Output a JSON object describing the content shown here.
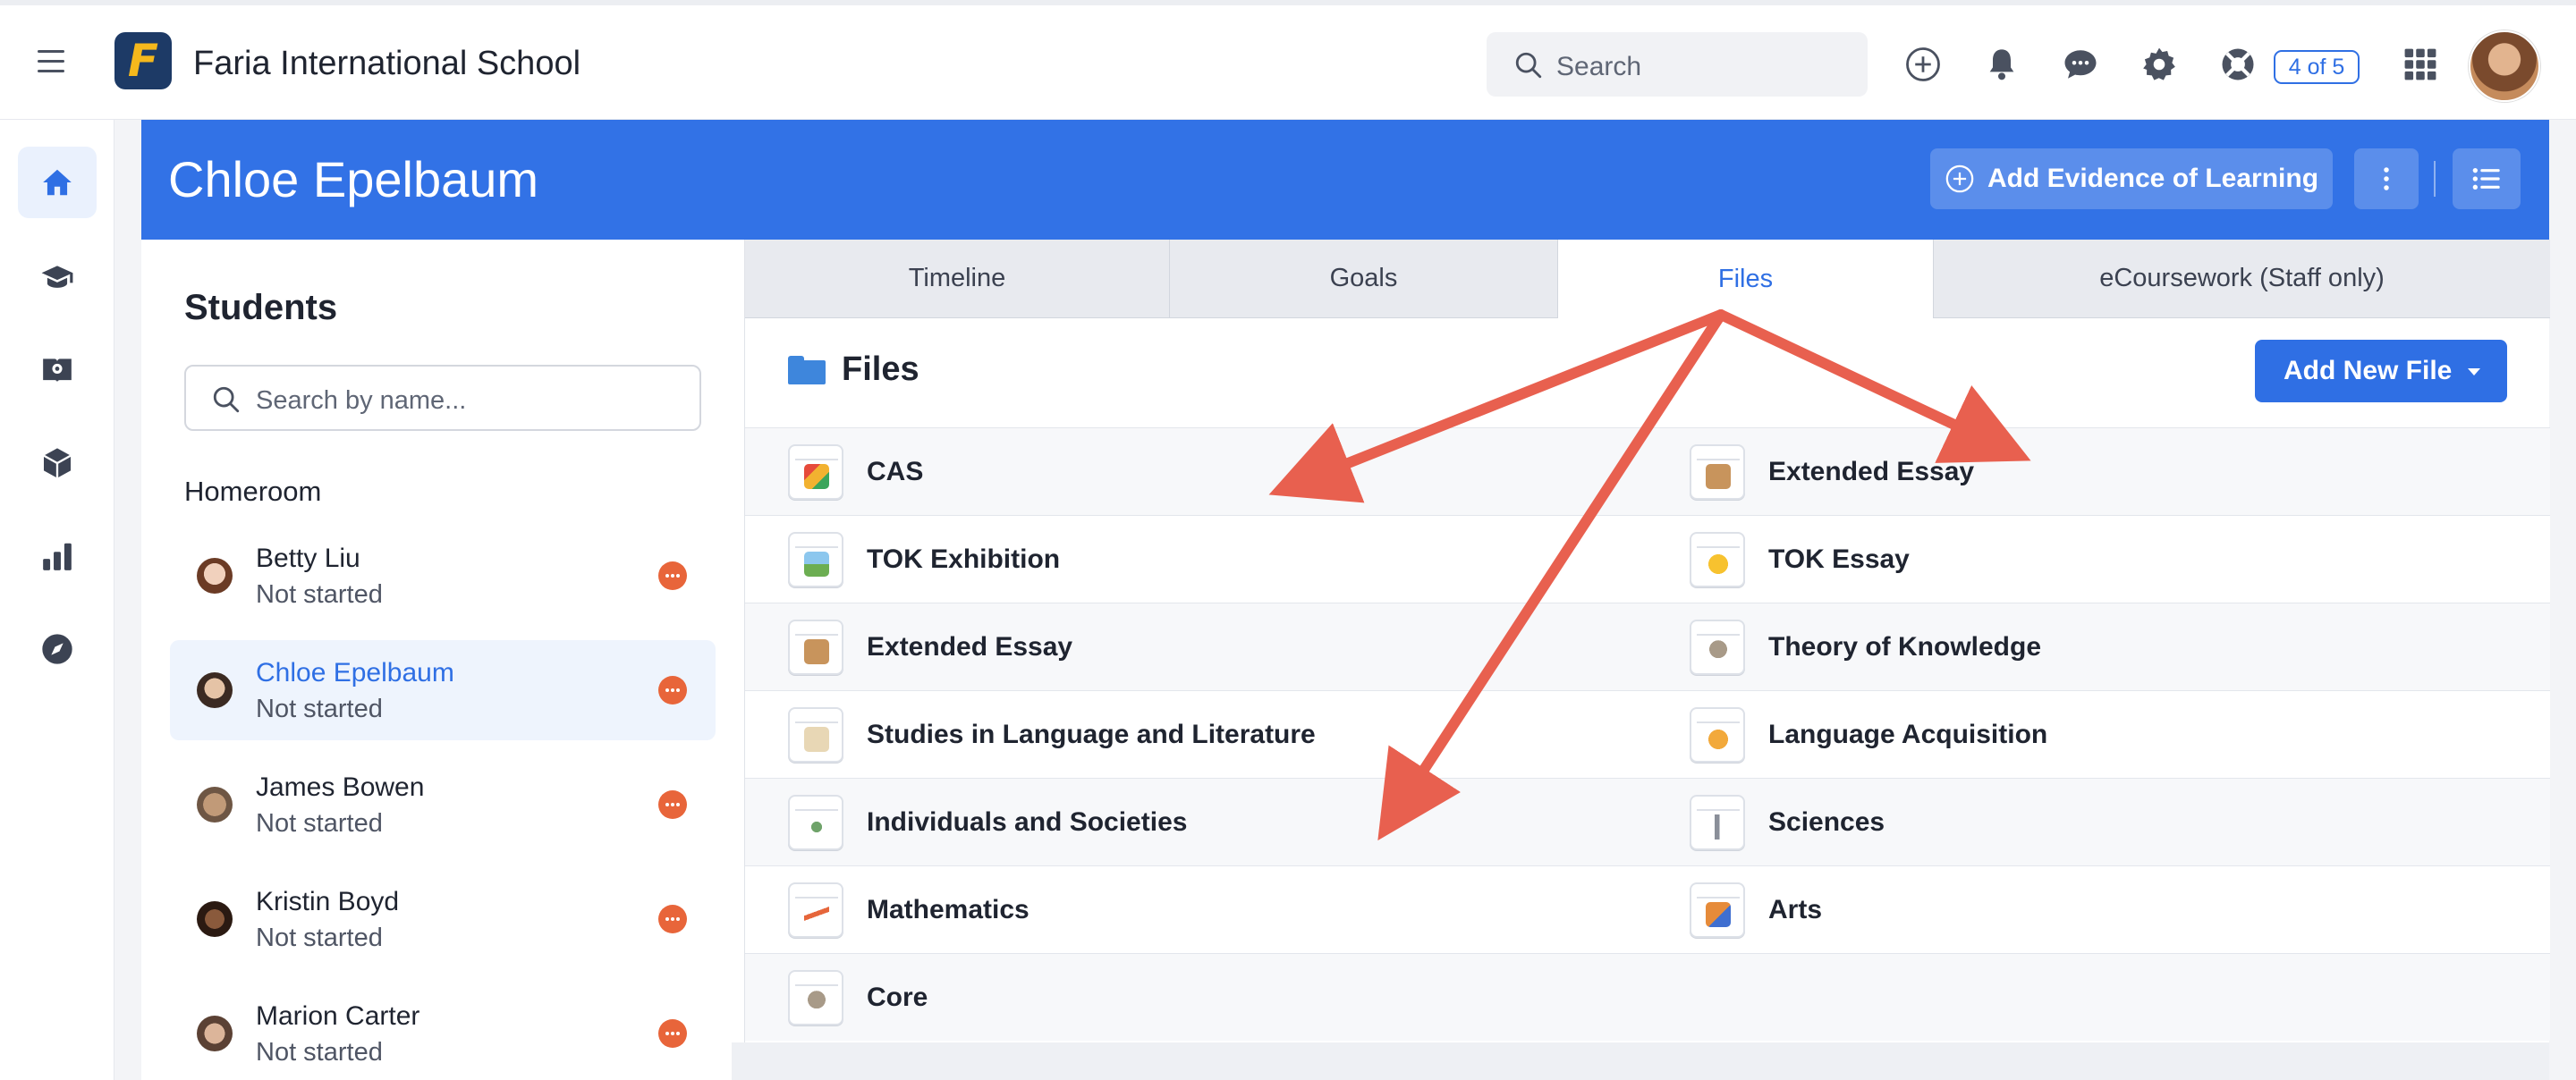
{
  "topbar": {
    "school_name": "Faria International School",
    "logo_letter": "F",
    "search_placeholder": "Search",
    "tasks_badge": "4 of 5",
    "icons": [
      "menu-icon",
      "plus-circle-icon",
      "bell-icon",
      "chat-icon",
      "gear-icon",
      "lifebuoy-icon",
      "apps-grid-icon",
      "user-avatar"
    ]
  },
  "rail": {
    "items": [
      "home-icon",
      "graduation-cap-icon",
      "book-icon",
      "cube-icon",
      "bar-chart-icon",
      "compass-icon"
    ],
    "active": "home-icon"
  },
  "header": {
    "student_name": "Chloe Epelbaum",
    "add_evidence_label": "Add Evidence of Learning"
  },
  "students": {
    "title": "Students",
    "search_placeholder": "Search by name...",
    "group": "Homeroom",
    "items": [
      {
        "name": "Betty Liu",
        "status": "Not started"
      },
      {
        "name": "Chloe Epelbaum",
        "status": "Not started",
        "active": true
      },
      {
        "name": "James Bowen",
        "status": "Not started"
      },
      {
        "name": "Kristin Boyd",
        "status": "Not started"
      },
      {
        "name": "Marion Carter",
        "status": "Not started"
      }
    ]
  },
  "tabs": [
    {
      "label": "Timeline"
    },
    {
      "label": "Goals"
    },
    {
      "label": "Files",
      "active": true
    },
    {
      "label": "eCoursework (Staff only)"
    }
  ],
  "files": {
    "title": "Files",
    "add_button": "Add New File",
    "folders": [
      [
        "CAS",
        "Extended Essay"
      ],
      [
        "TOK Exhibition",
        "TOK Essay"
      ],
      [
        "Extended Essay",
        "Theory of Knowledge"
      ],
      [
        "Studies in Language and Literature",
        "Language Acquisition"
      ],
      [
        "Individuals and Societies",
        "Sciences"
      ],
      [
        "Mathematics",
        "Arts"
      ],
      [
        "Core"
      ]
    ]
  },
  "colors": {
    "accent": "#2f6fe4",
    "header_bg": "#3272e6",
    "status_dot": "#e8653a",
    "annotation_arrow": "#e8604f"
  }
}
